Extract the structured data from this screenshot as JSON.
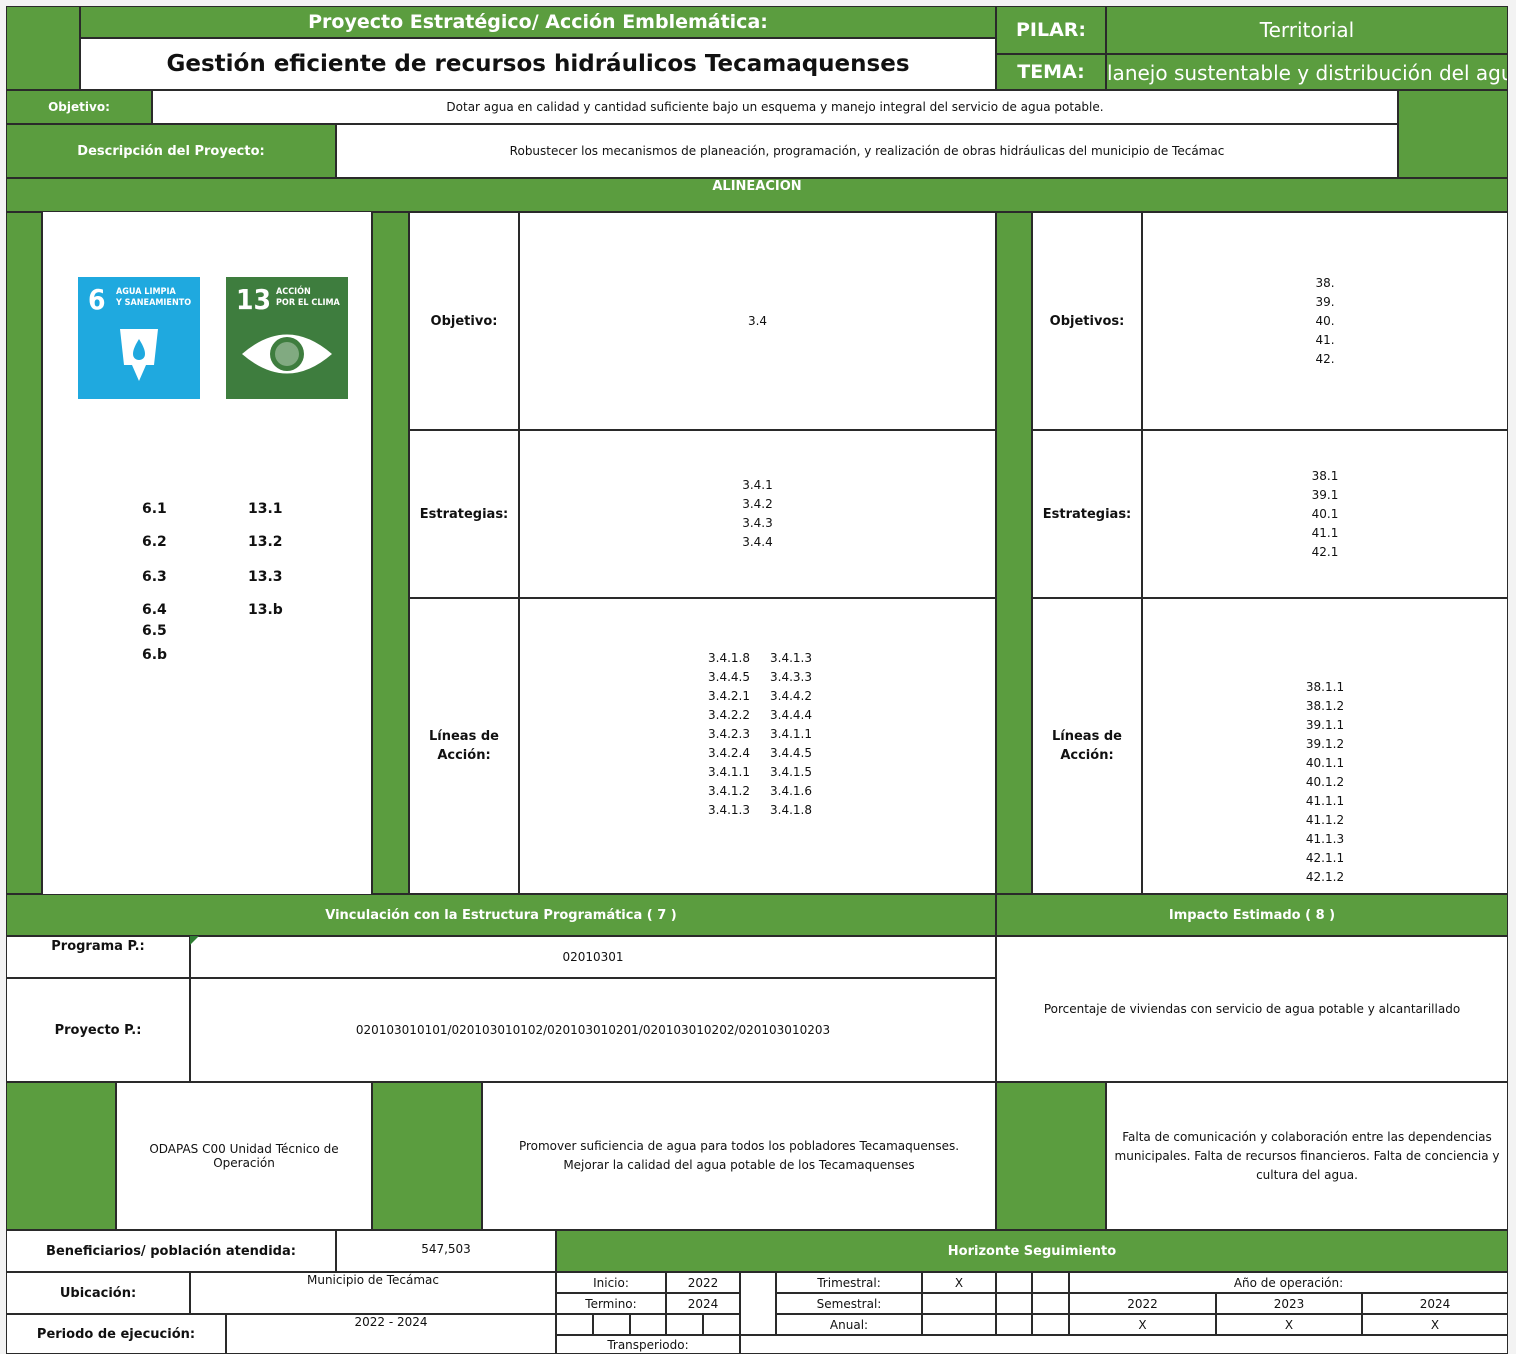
{
  "header": {
    "proyecto_label": "Proyecto Estratégico/ Acción Emblemática:",
    "title": "Gestión eficiente de recursos hidráulicos Tecamaquenses",
    "pilar_label": "PILAR:",
    "pilar_value": "Territorial",
    "tema_label": "TEMA:",
    "tema_value": "lanejo sustentable y distribución del agu"
  },
  "objetivo": {
    "label": "Objetivo:",
    "text": "Dotar agua en calidad y cantidad suficiente bajo un esquema y manejo integral del servicio de agua potable."
  },
  "descripcion": {
    "label": "Descripción del Proyecto:",
    "text": "Robustecer los mecanismos de planeación, programación, y realización de obras hidráulicas del municipio de Tecámac"
  },
  "alineacion": {
    "title": "ALINEACIÓN",
    "sdg6": {
      "number": "6",
      "text": "AGUA LIMPIA\nY SANEAMIENTO",
      "color": "#1fa9df"
    },
    "sdg13": {
      "number": "13",
      "text": "ACCIÓN\nPOR EL CLIMA",
      "color": "#3e7d3e"
    },
    "goals_6": [
      "6.1",
      "6.2",
      "6.3",
      "6.4",
      "6.5",
      "6.b"
    ],
    "goals_13": [
      "13.1",
      "13.2",
      "13.3",
      "13.b"
    ],
    "mid": {
      "objetivo_label": "Objetivo:",
      "objetivo_value": "3.4",
      "estrategias_label": "Estrategias:",
      "estrategias_value": "3.4.1\n3.4.2\n3.4.3\n3.4.4",
      "lineas_label": "Líneas de\nAcción:",
      "lineas_col1": "3.4.1.8\n3.4.4.5\n3.4.2.1\n3.4.2.2\n3.4.2.3\n3.4.2.4\n3.4.1.1\n3.4.1.2\n3.4.1.3",
      "lineas_col2": "3.4.1.3\n3.4.3.3\n3.4.4.2\n3.4.4.4\n3.4.1.1\n3.4.4.5\n3.4.1.5\n3.4.1.6\n3.4.1.8"
    },
    "right": {
      "objetivos_label": "Objetivos:",
      "objetivos_value": "38.\n39.\n40.\n41.\n42.",
      "estrategias_label": "Estrategias:",
      "estrategias_value": "38.1\n39.1\n40.1\n41.1\n42.1",
      "lineas_label": "Líneas de\nAcción:",
      "lineas_value": "38.1.1\n38.1.2\n39.1.1\n39.1.2\n40.1.1\n40.1.2\n41.1.1\n41.1.2\n41.1.3\n42.1.1\n42.1.2"
    }
  },
  "vinculacion": {
    "title": "Vinculación con la  Estructura Programática ( 7 )",
    "programa_label": "Programa P.:",
    "programa_value": "02010301",
    "proyecto_label": "Proyecto P.:",
    "proyecto_value": "020103010101/020103010102/020103010201/020103010202/020103010203"
  },
  "impacto": {
    "title": "Impacto Estimado ( 8 )",
    "text": "Porcentaje de viviendas con servicio de agua potable y alcantarillado"
  },
  "responsables": {
    "unidad": "ODAPAS C00 Unidad Técnico de Operación",
    "metas": "Promover suficiencia de agua para todos los pobladores Tecamaquenses.\nMejorar la calidad del agua potable de los Tecamaquenses",
    "riesgos": "Falta de comunicación y colaboración entre las dependencias municipales. Falta de recursos financieros. Falta de conciencia y cultura del agua."
  },
  "footer": {
    "beneficiarios_label": "Beneficiarios/ población atendida:",
    "beneficiarios_value": "547,503",
    "ubicacion_label": "Ubicación:",
    "ubicacion_value": "Municipio de Tecámac",
    "periodo_label": "Periodo de ejecución:",
    "periodo_value": "2022 - 2024",
    "horizonte_title": "Horizonte Seguimiento",
    "inicio_label": "Inicio:",
    "inicio_value": "2022",
    "termino_label": "Termino:",
    "termino_value": "2024",
    "transperiodo_label": "Transperiodo:",
    "trimestral_label": "Trimestral:",
    "trimestral_value": "X",
    "semestral_label": "Semestral:",
    "anual_label": "Anual:",
    "anio_label": "Año de operación:",
    "years": [
      "2022",
      "2023",
      "2024"
    ],
    "year_marks": [
      "X",
      "X",
      "X"
    ]
  },
  "colors": {
    "green": "#5b9d3f",
    "sdg6": "#1fa9df",
    "sdg13": "#3e7d3e"
  }
}
